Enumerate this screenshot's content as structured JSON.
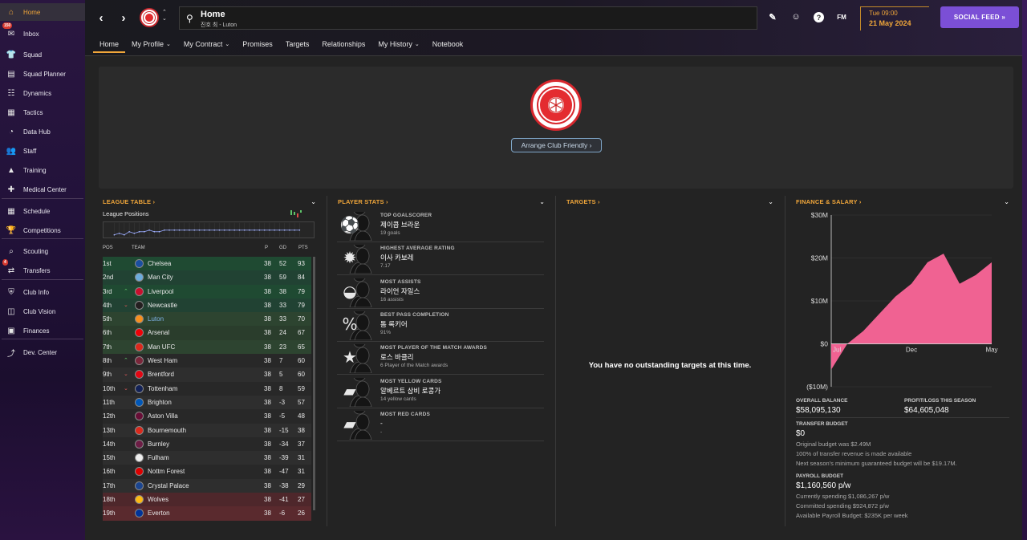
{
  "sidebar": {
    "items": [
      {
        "label": "Home",
        "icon": "home-icon",
        "glyph": "⌂"
      },
      {
        "label": "Inbox",
        "icon": "inbox-icon",
        "glyph": "✉",
        "badge": "150"
      },
      {
        "label": "Squad",
        "icon": "shirt-icon",
        "glyph": "👕"
      },
      {
        "label": "Squad Planner",
        "icon": "planner-icon",
        "glyph": "▤"
      },
      {
        "label": "Dynamics",
        "icon": "dynamics-icon",
        "glyph": "☷"
      },
      {
        "label": "Tactics",
        "icon": "tactics-icon",
        "glyph": "▦"
      },
      {
        "label": "Data Hub",
        "icon": "datahub-icon",
        "glyph": "◔"
      },
      {
        "label": "Staff",
        "icon": "staff-icon",
        "glyph": "👥"
      },
      {
        "label": "Training",
        "icon": "training-icon",
        "glyph": "▲"
      },
      {
        "label": "Medical Center",
        "icon": "medical-icon",
        "glyph": "✚"
      },
      {
        "label": "Schedule",
        "icon": "calendar-icon",
        "glyph": "▦"
      },
      {
        "label": "Competitions",
        "icon": "trophy-icon",
        "glyph": "🏆"
      },
      {
        "label": "Scouting",
        "icon": "scouting-icon",
        "glyph": "⌕"
      },
      {
        "label": "Transfers",
        "icon": "transfers-icon",
        "glyph": "⇄",
        "badge": "4"
      },
      {
        "label": "Club Info",
        "icon": "shield-icon",
        "glyph": "⛨"
      },
      {
        "label": "Club Vision",
        "icon": "vision-icon",
        "glyph": "◫"
      },
      {
        "label": "Finances",
        "icon": "finances-icon",
        "glyph": "▣"
      },
      {
        "label": "Dev. Center",
        "icon": "dev-center-icon",
        "glyph": "⤴"
      }
    ]
  },
  "search": {
    "title": "Home",
    "subtitle": "진호 최 - Luton"
  },
  "date": {
    "day": "Tue 09:00",
    "date": "21 May 2024"
  },
  "social_feed": "SOCIAL FEED  »",
  "toolbar": {
    "fm_label": "FM"
  },
  "tabs": [
    {
      "label": "Home",
      "chev": ""
    },
    {
      "label": "My Profile",
      "chev": "⌄"
    },
    {
      "label": "My Contract",
      "chev": "⌄"
    },
    {
      "label": "Promises",
      "chev": ""
    },
    {
      "label": "Targets",
      "chev": ""
    },
    {
      "label": "Relationships",
      "chev": ""
    },
    {
      "label": "My History",
      "chev": "⌄"
    },
    {
      "label": "Notebook",
      "chev": ""
    }
  ],
  "hero": {
    "button": "Arrange Club Friendly ›"
  },
  "league_table": {
    "title": "LEAGUE TABLE ›",
    "positions_label": "League Positions",
    "position_history": [
      8,
      7,
      8,
      6,
      7,
      6,
      6,
      5,
      6,
      6,
      5,
      5,
      5,
      5,
      5,
      5,
      5,
      5,
      5,
      5,
      5,
      5,
      5,
      5,
      5,
      5,
      5,
      5,
      5,
      5,
      5,
      5,
      5,
      5,
      5,
      5,
      5,
      5
    ],
    "headers": {
      "pos": "POS",
      "team": "TEAM",
      "p": "P",
      "gd": "GD",
      "pts": "PTS"
    },
    "rows": [
      {
        "pos": "1st",
        "team": "Chelsea",
        "p": "38",
        "gd": "52",
        "pts": "93",
        "trend": ""
      },
      {
        "pos": "2nd",
        "team": "Man City",
        "p": "38",
        "gd": "59",
        "pts": "84",
        "trend": ""
      },
      {
        "pos": "3rd",
        "team": "Liverpool",
        "p": "38",
        "gd": "38",
        "pts": "79",
        "trend": "up"
      },
      {
        "pos": "4th",
        "team": "Newcastle",
        "p": "38",
        "gd": "33",
        "pts": "79",
        "trend": "down"
      },
      {
        "pos": "5th",
        "team": "Luton",
        "p": "38",
        "gd": "33",
        "pts": "70",
        "trend": ""
      },
      {
        "pos": "6th",
        "team": "Arsenal",
        "p": "38",
        "gd": "24",
        "pts": "67",
        "trend": ""
      },
      {
        "pos": "7th",
        "team": "Man UFC",
        "p": "38",
        "gd": "23",
        "pts": "65",
        "trend": ""
      },
      {
        "pos": "8th",
        "team": "West Ham",
        "p": "38",
        "gd": "7",
        "pts": "60",
        "trend": "up"
      },
      {
        "pos": "9th",
        "team": "Brentford",
        "p": "38",
        "gd": "5",
        "pts": "60",
        "trend": "down"
      },
      {
        "pos": "10th",
        "team": "Tottenham",
        "p": "38",
        "gd": "8",
        "pts": "59",
        "trend": "down"
      },
      {
        "pos": "11th",
        "team": "Brighton",
        "p": "38",
        "gd": "-3",
        "pts": "57",
        "trend": ""
      },
      {
        "pos": "12th",
        "team": "Aston Villa",
        "p": "38",
        "gd": "-5",
        "pts": "48",
        "trend": ""
      },
      {
        "pos": "13th",
        "team": "Bournemouth",
        "p": "38",
        "gd": "-15",
        "pts": "38",
        "trend": ""
      },
      {
        "pos": "14th",
        "team": "Burnley",
        "p": "38",
        "gd": "-34",
        "pts": "37",
        "trend": ""
      },
      {
        "pos": "15th",
        "team": "Fulham",
        "p": "38",
        "gd": "-39",
        "pts": "31",
        "trend": ""
      },
      {
        "pos": "16th",
        "team": "Nottm Forest",
        "p": "38",
        "gd": "-47",
        "pts": "31",
        "trend": ""
      },
      {
        "pos": "17th",
        "team": "Crystal Palace",
        "p": "38",
        "gd": "-38",
        "pts": "29",
        "trend": ""
      },
      {
        "pos": "18th",
        "team": "Wolves",
        "p": "38",
        "gd": "-41",
        "pts": "27",
        "trend": ""
      },
      {
        "pos": "19th",
        "team": "Everton",
        "p": "38",
        "gd": "-6",
        "pts": "26",
        "trend": ""
      }
    ]
  },
  "player_stats": {
    "title": "PLAYER STATS ›",
    "items": [
      {
        "label": "TOP GOALSCORER",
        "name": "제이콥 브라운",
        "value": "19 goals",
        "icon": "ball-icon"
      },
      {
        "label": "HIGHEST AVERAGE RATING",
        "name": "이사 카보레",
        "value": "7.17",
        "icon": "rating-icon"
      },
      {
        "label": "MOST ASSISTS",
        "name": "라이언 자일스",
        "value": "16 assists",
        "icon": "assist-icon"
      },
      {
        "label": "BEST PASS COMPLETION",
        "name": "톰 록키어",
        "value": "91%",
        "icon": "percent-icon"
      },
      {
        "label": "MOST PLAYER OF THE MATCH AWARDS",
        "name": "로스 바클리",
        "value": "6 Player of the Match awards",
        "icon": "star-icon"
      },
      {
        "label": "MOST YELLOW CARDS",
        "name": "알베르트 삼비 로콩가",
        "value": "14 yellow cards",
        "icon": "yellow-card-icon"
      },
      {
        "label": "MOST RED CARDS",
        "name": "-",
        "value": "-",
        "icon": "red-card-icon"
      }
    ]
  },
  "targets": {
    "title": "TARGETS ›",
    "empty": "You have no outstanding targets at this time."
  },
  "finance": {
    "title": "FINANCE & SALARY ›",
    "overall_balance_label": "OVERALL BALANCE",
    "overall_balance": "$58,095,130",
    "profit_label": "PROFIT/LOSS THIS SEASON",
    "profit": "$64,605,048",
    "transfer_budget_label": "TRANSFER BUDGET",
    "transfer_budget": "$0",
    "transfer_notes": [
      "Original budget was $2.49M",
      "100% of transfer revenue is made available",
      "Next season's minimum guaranteed budget will be $19.17M."
    ],
    "payroll_label": "PAYROLL BUDGET",
    "payroll": "$1,160,560 p/w",
    "payroll_notes": [
      "Currently spending $1,086,267 p/w",
      "Committed spending $924,872 p/w",
      "Available Payroll Budget: $235K per week"
    ]
  },
  "chart_data": {
    "type": "area",
    "x": [
      "Jul",
      "Aug",
      "Sep",
      "Oct",
      "Nov",
      "Dec",
      "Jan",
      "Feb",
      "Mar",
      "Apr",
      "May"
    ],
    "values": [
      -6,
      0,
      3,
      7,
      11,
      14,
      19,
      21,
      14,
      16,
      19
    ],
    "ylim": [
      -10,
      30
    ],
    "y_ticks": [
      "$30M",
      "$20M",
      "$10M",
      "$0",
      "($10M)"
    ],
    "x_ticks": [
      "Jul",
      "Dec",
      "May"
    ],
    "color": "#f06292"
  },
  "colors": {
    "accent": "#f0a63a",
    "purple": "#7b4fd6",
    "cl": "#1f4a32",
    "el": "#2d4430",
    "rel": "#5a2a2e"
  }
}
